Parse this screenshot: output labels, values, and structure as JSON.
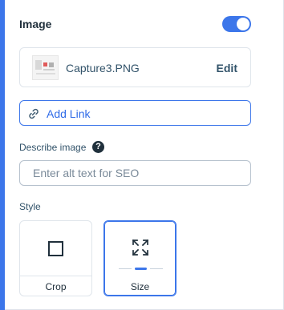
{
  "header": {
    "title": "Image",
    "toggle_on": true
  },
  "file": {
    "name": "Capture3.PNG",
    "edit_label": "Edit"
  },
  "link": {
    "label": "Add Link"
  },
  "describe": {
    "label": "Describe image",
    "help_glyph": "?",
    "placeholder": "Enter alt text for SEO",
    "value": ""
  },
  "style": {
    "label": "Style",
    "options": [
      {
        "label": "Crop",
        "icon": "crop-square-icon",
        "selected": false
      },
      {
        "label": "Size",
        "icon": "expand-arrows-icon",
        "selected": true
      }
    ]
  },
  "colors": {
    "accent": "#3c76ea",
    "text_dark": "#20303c",
    "text_body": "#32536a"
  }
}
